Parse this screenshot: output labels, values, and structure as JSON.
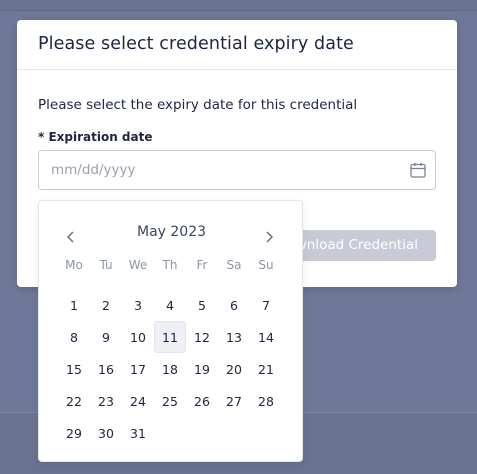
{
  "modal": {
    "title": "Please select credential expiry date",
    "description": "Please select the expiry date for this credential",
    "field_label": "* Expiration date",
    "date_placeholder": "mm/dd/yyyy",
    "download_button": "wnload Credential"
  },
  "calendar": {
    "month_label": "May 2023",
    "weekdays": [
      "Mo",
      "Tu",
      "We",
      "Th",
      "Fr",
      "Sa",
      "Su"
    ],
    "weeks": [
      [
        "1",
        "2",
        "3",
        "4",
        "5",
        "6",
        "7"
      ],
      [
        "8",
        "9",
        "10",
        "11",
        "12",
        "13",
        "14"
      ],
      [
        "15",
        "16",
        "17",
        "18",
        "19",
        "20",
        "21"
      ],
      [
        "22",
        "23",
        "24",
        "25",
        "26",
        "27",
        "28"
      ],
      [
        "29",
        "30",
        "31",
        "",
        "",
        "",
        ""
      ]
    ],
    "highlighted_day": "11"
  },
  "colors": {
    "backdrop": "#6f7898",
    "text": "#1e2540",
    "muted": "#8d94a6",
    "button_disabled": "#c8cad8"
  }
}
